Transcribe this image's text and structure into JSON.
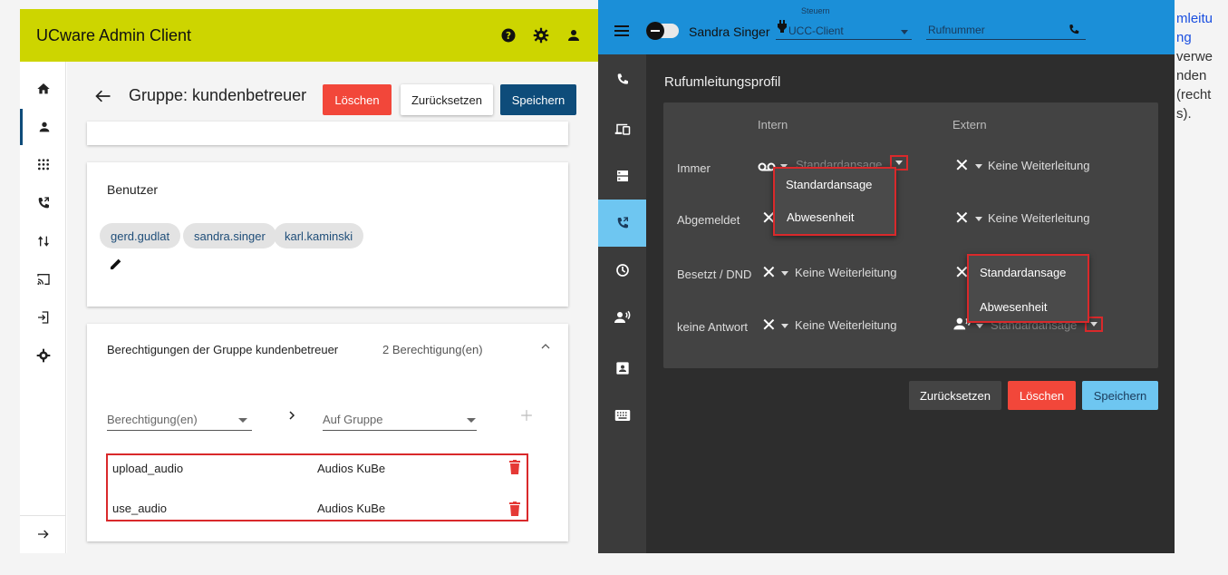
{
  "admin": {
    "title": "UCware Admin Client",
    "page_title": "Gruppe: kundenbetreuer",
    "buttons": {
      "delete": "Löschen",
      "reset": "Zurücksetzen",
      "save": "Speichern"
    },
    "users_section": {
      "title": "Benutzer",
      "chips": [
        "gerd.gudlat",
        "sandra.singer",
        "karl.kaminski"
      ]
    },
    "permissions_section": {
      "title": "Berechtigungen der Gruppe kundenbetreuer",
      "count": "2 Berechtigung(en)",
      "permission_select_placeholder": "Berechtigung(en)",
      "group_select_placeholder": "Auf Gruppe",
      "rows": [
        {
          "permission": "upload_audio",
          "group": "Audios KuBe"
        },
        {
          "permission": "use_audio",
          "group": "Audios KuBe"
        }
      ]
    },
    "nav_icons": [
      "home-icon",
      "user-icon",
      "dialpad-icon",
      "phone-forward-icon",
      "swap-vert-icon",
      "cast-icon",
      "login-icon",
      "gear-icon"
    ],
    "accent_color": "#cdd500"
  },
  "client": {
    "user_name": "Sandra Singer",
    "steuern_label": "Steuern",
    "steuern_value": "UCC-Client",
    "phone_placeholder": "Rufnummer",
    "section_title": "Rufumleitungsprofil",
    "columns": {
      "intern": "Intern",
      "extern": "Extern"
    },
    "rows": [
      {
        "label": "Immer",
        "intern": "Standardansage",
        "extern": "Keine Weiterleitung"
      },
      {
        "label": "Abgemeldet",
        "intern": "",
        "extern": "Keine Weiterleitung"
      },
      {
        "label": "Besetzt / DND",
        "intern": "Keine Weiterleitung",
        "extern": ""
      },
      {
        "label": "keine Antwort",
        "intern": "Keine Weiterleitung",
        "extern": "Standardansage"
      }
    ],
    "dropdown_options": [
      "Standardansage",
      "Abwesenheit"
    ],
    "buttons": {
      "reset": "Zurücksetzen",
      "delete": "Löschen",
      "save": "Speichern"
    },
    "header_color": "#1b8fd8"
  },
  "side_text": {
    "link": [
      "mleitu",
      "ng"
    ],
    "plain": [
      "verwe",
      "nden",
      "(recht",
      "s)."
    ]
  }
}
